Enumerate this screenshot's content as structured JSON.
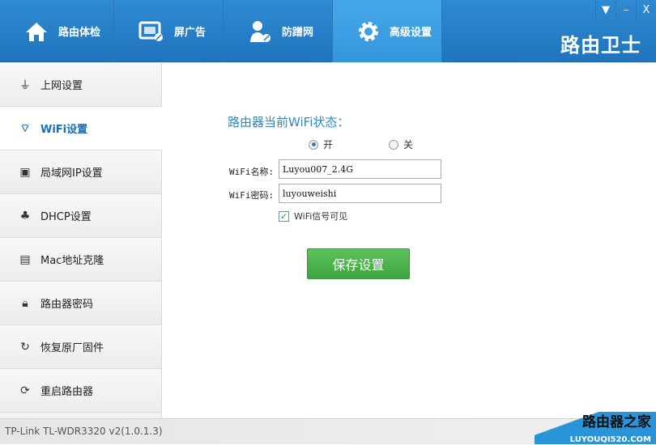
{
  "header": {
    "tabs": [
      {
        "label": "路由体检",
        "icon": "home-icon"
      },
      {
        "label": "屏广告",
        "icon": "ad-block-icon"
      },
      {
        "label": "防蹭网",
        "icon": "user-block-icon"
      },
      {
        "label": "高级设置",
        "icon": "gear-icon"
      }
    ],
    "active_tab": 3,
    "brand": "路由卫士",
    "window_buttons": {
      "menu": "▼",
      "minimize": "–",
      "close": "X"
    }
  },
  "sidebar": {
    "items": [
      {
        "label": "上网设置",
        "icon": "plug-icon"
      },
      {
        "label": "WiFi设置",
        "icon": "wifi-icon"
      },
      {
        "label": "局域网IP设置",
        "icon": "lan-icon"
      },
      {
        "label": "DHCP设置",
        "icon": "network-icon"
      },
      {
        "label": "Mac地址克隆",
        "icon": "card-icon"
      },
      {
        "label": "路由器密码",
        "icon": "lock-icon"
      },
      {
        "label": "恢复原厂固件",
        "icon": "restore-icon"
      },
      {
        "label": "重启路由器",
        "icon": "reboot-icon"
      }
    ],
    "active": 1
  },
  "main": {
    "title": "路由器当前WiFi状态：",
    "radio_on": "开",
    "radio_off": "关",
    "wifi_state": "on",
    "ssid_label": "WiFi名称:",
    "ssid_value": "Luyou007_2.4G",
    "pwd_label": "WiFi密码:",
    "pwd_value": "luyouweishi",
    "visible_label": "WiFi信号可见",
    "visible_checked": true,
    "save": "保存设置"
  },
  "footer": {
    "device": "TP-Link TL-WDR3320 v2(1.0.1.3)"
  },
  "watermark": {
    "line1": "路由器之家",
    "line2": "LUYOUQI520.COM"
  }
}
